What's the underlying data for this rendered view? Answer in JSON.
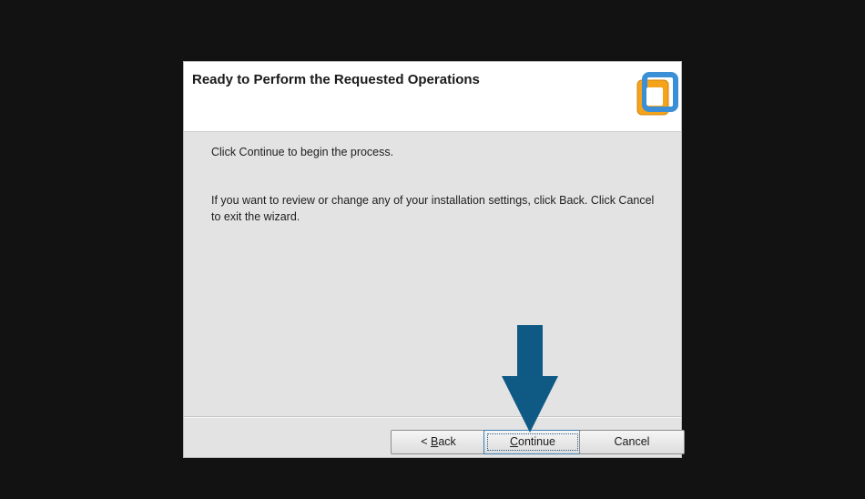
{
  "dialog": {
    "title": "Ready to Perform the Requested Operations",
    "logo_icon": "vmware-logo-icon",
    "line1": "Click Continue to begin the process.",
    "line2": "If you want to review or change any of your installation settings, click Back. Click Cancel to exit the wizard."
  },
  "buttons": {
    "back_prefix": "< ",
    "back_accel": "B",
    "back_rest": "ack",
    "continue_accel": "C",
    "continue_rest": "ontinue",
    "cancel": "Cancel"
  },
  "annotation": {
    "arrow_icon": "down-arrow-icon",
    "arrow_color": "#0e5a85"
  },
  "colors": {
    "background": "#121212",
    "dialog_body": "#e3e3e3",
    "logo_orange": "#f5a31a",
    "logo_blue": "#3b8fd6"
  }
}
